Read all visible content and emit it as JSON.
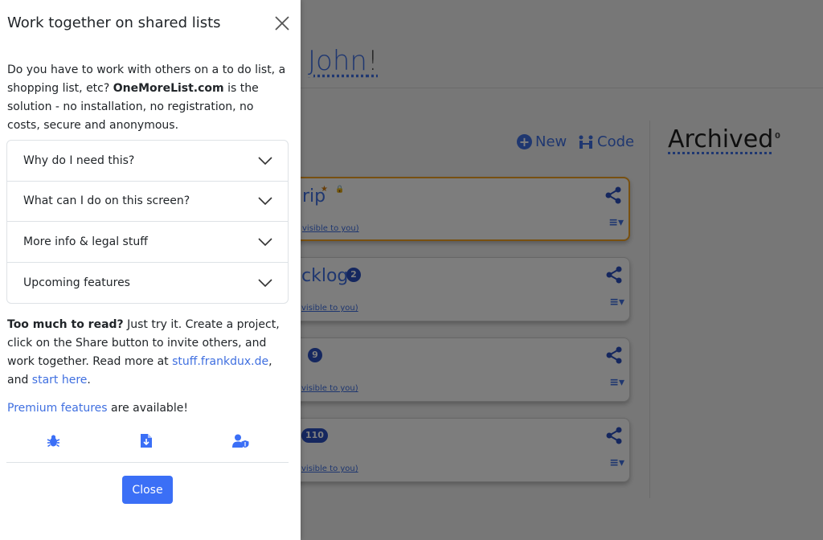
{
  "panel": {
    "title": "Work together on shared lists",
    "intro": {
      "part1": "Do you have to work with others on a to do list, a shopping list, etc? ",
      "brand": "OneMoreList.com",
      "part2": " is the solution - no installation, no registration, no costs, secure and anonymous."
    },
    "accordion": [
      {
        "label": "Why do I need this?"
      },
      {
        "label": "What can I do on this screen?"
      },
      {
        "label": "More info & legal stuff"
      },
      {
        "label": "Upcoming features"
      }
    ],
    "bottom": {
      "bold": "Too much to read?",
      "text1": " Just try it. Create a project, click on the Share button to invite others, and work together. Read more at ",
      "link1": "stuff.frankdux.de",
      "text2": ", and ",
      "link2": "start here",
      "text3": "."
    },
    "premium": {
      "link": "Premium features",
      "text": " are available!"
    },
    "icons": [
      "bug-icon",
      "file-download-icon",
      "user-shield-icon"
    ],
    "close_label": "Close"
  },
  "background": {
    "greeting_name": "John",
    "greeting_punct": "!",
    "toolbar": {
      "new_label": "New",
      "code_label": "Code"
    },
    "archived": {
      "title": "Archived",
      "count": "0"
    },
    "lists": [
      {
        "title": "rip",
        "badge": "",
        "sub": "visible to you)"
      },
      {
        "title": "cklog",
        "badge": "2",
        "sub": "visible to you)"
      },
      {
        "title": "",
        "badge": "9",
        "sub": "visible to you)"
      },
      {
        "title": "",
        "badge": "110",
        "sub": "visible to you)"
      }
    ]
  },
  "colors": {
    "accent": "#3f6fe0",
    "button": "#3b6ff6",
    "highlight": "#f0a020"
  }
}
